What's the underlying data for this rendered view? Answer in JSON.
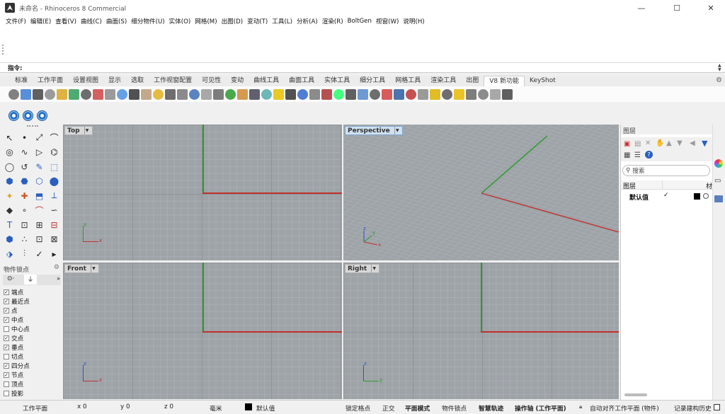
{
  "window": {
    "title": "未命名 - Rhinoceros 8 Commercial",
    "minimize": "—",
    "maximize": "☐",
    "close": "✕"
  },
  "menu": [
    "文件(F)",
    "编辑(E)",
    "查看(V)",
    "曲线(C)",
    "曲面(S)",
    "细分物件(U)",
    "实体(O)",
    "网格(M)",
    "出图(D)",
    "变动(T)",
    "工具(L)",
    "分析(A)",
    "渲染(R)",
    "BoltGen",
    "视窗(W)",
    "说明(H)"
  ],
  "command": {
    "label": "指令:",
    "value": ""
  },
  "tabs": [
    "标准",
    "工作平面",
    "设置视图",
    "显示",
    "选取",
    "工作视窗配置",
    "可见性",
    "变动",
    "曲线工具",
    "曲面工具",
    "实体工具",
    "细分工具",
    "网格工具",
    "渲染工具",
    "出图",
    "V8 新功能",
    "KeyShot"
  ],
  "active_tab": "V8 新功能",
  "viewports": [
    {
      "name": "Top"
    },
    {
      "name": "Perspective"
    },
    {
      "name": "Front"
    },
    {
      "name": "Right"
    }
  ],
  "axis_labels": {
    "x": "x",
    "y": "y",
    "z": "z"
  },
  "osnap": {
    "title": "物件锁点",
    "items": [
      {
        "label": "端点",
        "checked": true
      },
      {
        "label": "最近点",
        "checked": true
      },
      {
        "label": "点",
        "checked": true
      },
      {
        "label": "中点",
        "checked": true
      },
      {
        "label": "中心点",
        "checked": false
      },
      {
        "label": "交点",
        "checked": true
      },
      {
        "label": "垂点",
        "checked": true
      },
      {
        "label": "切点",
        "checked": false
      },
      {
        "label": "四分点",
        "checked": true
      },
      {
        "label": "节点",
        "checked": true
      },
      {
        "label": "顶点",
        "checked": false
      },
      {
        "label": "投影",
        "checked": false
      }
    ]
  },
  "layers": {
    "title": "图层",
    "search_placeholder": "搜索",
    "col_layer": "图层",
    "col_material": "材",
    "rows": [
      {
        "name": "默认值",
        "current": "✓",
        "color": "#000000"
      }
    ]
  },
  "status": {
    "cplane": "工作平面",
    "x": "x 0",
    "y": "y 0",
    "z": "z 0",
    "units": "毫米",
    "layer": "默认值",
    "grid_snap": "锁定格点",
    "ortho": "正交",
    "planar": "平面模式",
    "osnap": "物件锁点",
    "smarttrack": "智慧轨迹",
    "gumball": "操作轴 (工作平面)",
    "autoalign": "自动对齐工作平面 (物件)",
    "history": "记录建构历史"
  },
  "colors": {
    "x_axis": "#c0302c",
    "y_axis": "#2a9a2a",
    "z_axis": "#2b4fd0",
    "viewport_bg": "#9ea3a8",
    "active_label": "#cfe0f0"
  }
}
